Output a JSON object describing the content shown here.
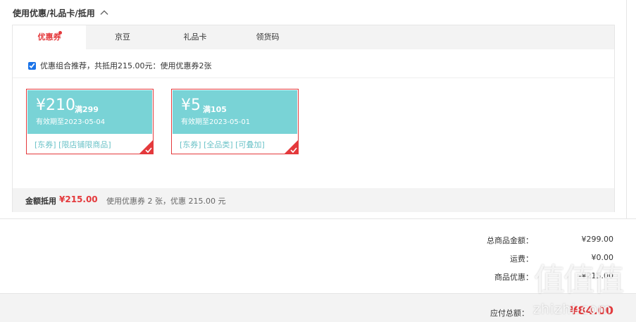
{
  "section": {
    "title": "使用优惠/礼品卡/抵用"
  },
  "tabs": [
    {
      "label": "优惠券"
    },
    {
      "label": "京豆"
    },
    {
      "label": "礼品卡"
    },
    {
      "label": "领货码"
    }
  ],
  "combo": {
    "text": "优惠组合推荐，共抵用215.00元：使用优惠券2张"
  },
  "coupons": [
    {
      "currency": "¥",
      "amount": "210",
      "condition": "满299",
      "validity": "有效期至2023-05-04",
      "tags": "[东券] [限店铺限商品]"
    },
    {
      "currency": "¥",
      "amount": "5",
      "condition": "满105",
      "validity": "有效期至2023-05-01",
      "tags": "[东券] [全品类] [可叠加]"
    }
  ],
  "summary": {
    "label": "金额抵用",
    "value": "¥215.00",
    "desc": "使用优惠券 2 张，优惠 215.00 元"
  },
  "totals": [
    {
      "label": "总商品金额：",
      "value": "¥299.00"
    },
    {
      "label": "运费：",
      "value": "¥0.00"
    },
    {
      "label": "商品优惠：",
      "value": "-¥215.00"
    }
  ],
  "payable": {
    "label": "应付总额：",
    "value": "¥84.00"
  },
  "watermark": {
    "chars": "值值值",
    "site": "zhizhi.com"
  },
  "colors": {
    "accent": "#e4393c",
    "coupon_bg": "#79d3d6",
    "tag": "#6cc3c8"
  }
}
